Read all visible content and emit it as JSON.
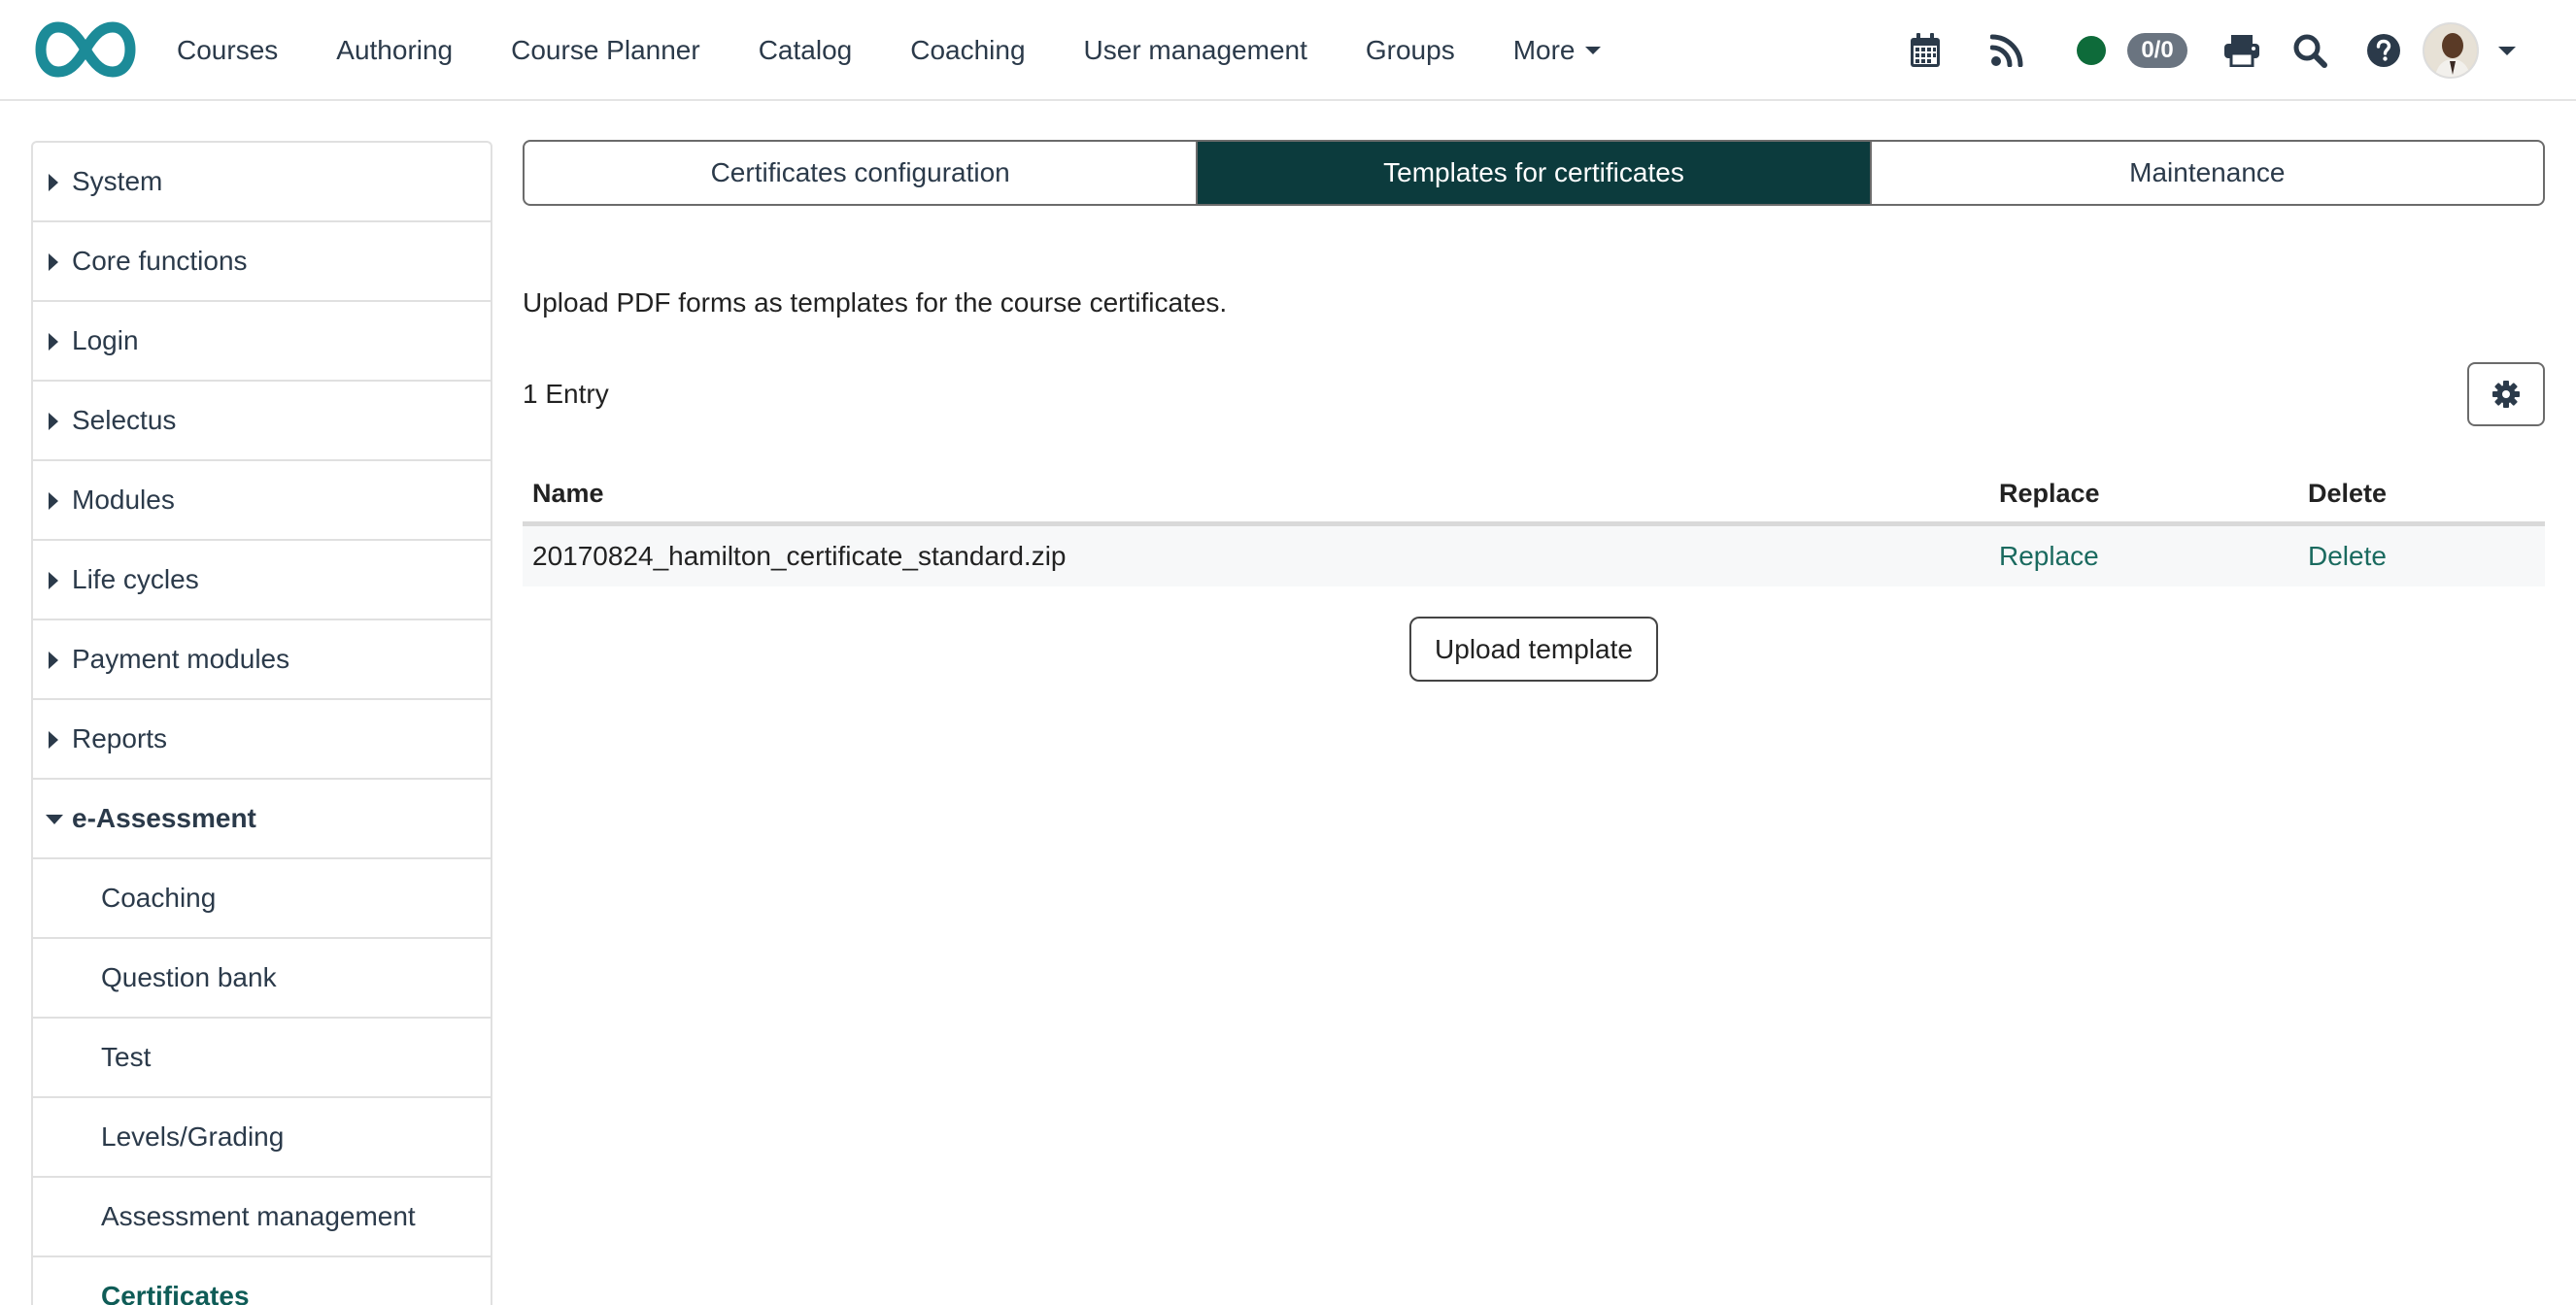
{
  "navbar": {
    "items": [
      {
        "label": "Courses"
      },
      {
        "label": "Authoring"
      },
      {
        "label": "Course Planner"
      },
      {
        "label": "Catalog"
      },
      {
        "label": "Coaching"
      },
      {
        "label": "User management"
      },
      {
        "label": "Groups"
      },
      {
        "label": "More"
      }
    ],
    "badge": "0/0",
    "status_color": "#0e6b3a"
  },
  "sidebar": {
    "items": [
      {
        "label": "System"
      },
      {
        "label": "Core functions"
      },
      {
        "label": "Login"
      },
      {
        "label": "Selectus"
      },
      {
        "label": "Modules"
      },
      {
        "label": "Life cycles"
      },
      {
        "label": "Payment modules"
      },
      {
        "label": "Reports"
      },
      {
        "label": "e-Assessment"
      }
    ],
    "subitems": [
      {
        "label": "Coaching"
      },
      {
        "label": "Question bank"
      },
      {
        "label": "Test"
      },
      {
        "label": "Levels/Grading"
      },
      {
        "label": "Assessment management"
      },
      {
        "label": "Certificates"
      }
    ]
  },
  "tabs": [
    {
      "label": "Certificates configuration"
    },
    {
      "label": "Templates for certificates"
    },
    {
      "label": "Maintenance"
    }
  ],
  "main": {
    "description": "Upload PDF forms as templates for the course certificates.",
    "entry_count": "1 Entry",
    "table": {
      "headers": {
        "name": "Name",
        "replace": "Replace",
        "delete": "Delete"
      },
      "rows": [
        {
          "name": "20170824_hamilton_certificate_standard.zip",
          "replace": "Replace",
          "delete": "Delete"
        }
      ]
    },
    "upload_label": "Upload template"
  },
  "colors": {
    "accent": "#0c3b3d",
    "link": "#1a6a5f",
    "logo": "#1c8b98"
  }
}
